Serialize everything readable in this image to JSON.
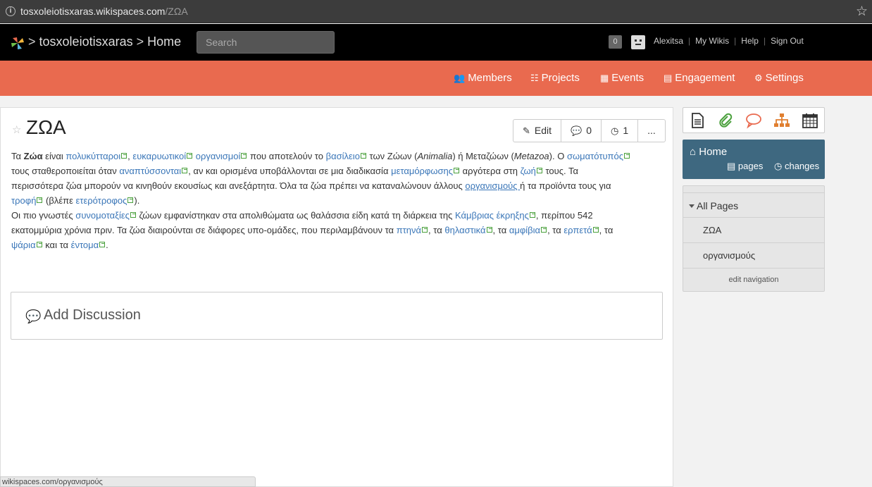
{
  "browser": {
    "url_host": "tosxoleiotisxaras.wikispaces.com",
    "url_path": "/ΖΩΑ"
  },
  "topbar": {
    "wiki_name": "tosxoleiotisxaras",
    "separator": ">",
    "page": "Home",
    "search_placeholder": "Search",
    "notifications": "0",
    "username": "Alexitsa",
    "my_wikis": "My Wikis",
    "help": "Help",
    "sign_out": "Sign Out"
  },
  "nav": {
    "members": "Members",
    "projects": "Projects",
    "events": "Events",
    "engagement": "Engagement",
    "settings": "Settings"
  },
  "page": {
    "title": "ΖΩΑ",
    "edit_label": "Edit",
    "comments_count": "0",
    "history_count": "1",
    "more_label": "..."
  },
  "discussion": {
    "label": "Add Discussion"
  },
  "statusbar": {
    "text": "wikispaces.com/οργανισμούς"
  },
  "sidebar": {
    "home": "Home",
    "pages": "pages",
    "changes": "changes",
    "all_pages": "All Pages",
    "items": [
      "ΖΩΑ",
      "οργανισμούς"
    ],
    "edit_navigation": "edit navigation"
  },
  "colors": {
    "accent": "#e96a4f",
    "home_box": "#3e6880",
    "link": "#3a76b8",
    "topbar": "#000000"
  },
  "icons": [
    "info-icon",
    "bookmark-star-icon",
    "wikispaces-logo",
    "members-icon",
    "projects-icon",
    "events-icon",
    "engagement-icon",
    "settings-icon",
    "pencil-icon",
    "comment-icon",
    "clock-icon",
    "page-icon",
    "paperclip-icon",
    "speech-bubble-icon",
    "sitemap-icon",
    "calendar-icon",
    "home-icon"
  ]
}
